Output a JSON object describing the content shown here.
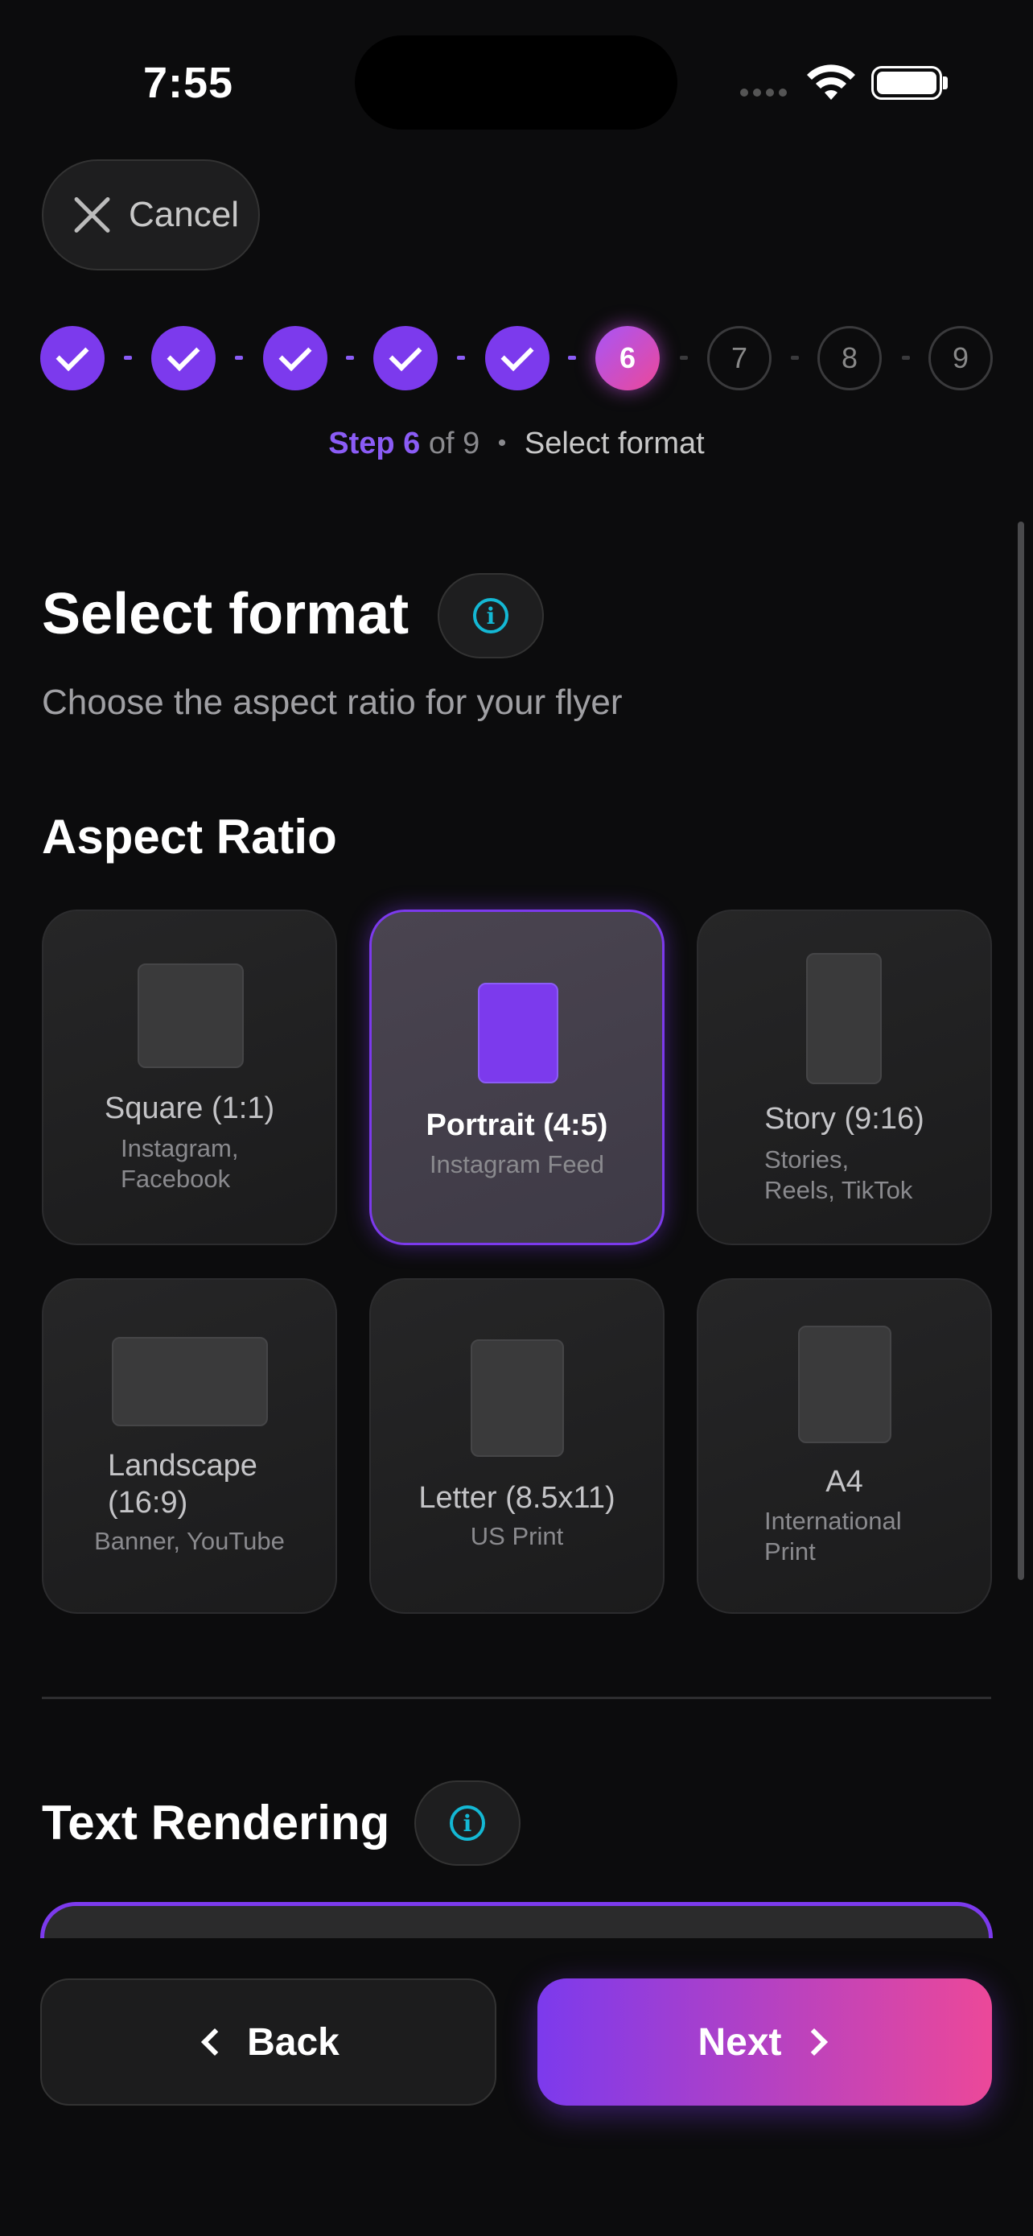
{
  "status_bar": {
    "time": "7:55"
  },
  "header": {
    "cancel_label": "Cancel"
  },
  "stepper": {
    "steps": [
      {
        "number": "1",
        "state": "done"
      },
      {
        "number": "2",
        "state": "done"
      },
      {
        "number": "3",
        "state": "done"
      },
      {
        "number": "4",
        "state": "done"
      },
      {
        "number": "5",
        "state": "done"
      },
      {
        "number": "6",
        "state": "current"
      },
      {
        "number": "7",
        "state": "todo"
      },
      {
        "number": "8",
        "state": "todo"
      },
      {
        "number": "9",
        "state": "todo"
      }
    ],
    "caption_step": "Step 6",
    "caption_of": "of 9",
    "caption_separator": "•",
    "caption_name": "Select format"
  },
  "page": {
    "title": "Select format",
    "subtitle": "Choose the aspect ratio for your flyer"
  },
  "aspect_ratio": {
    "heading": "Aspect Ratio",
    "selected": "Portrait (4:5)",
    "options": [
      {
        "title": "Square (1:1)",
        "desc_line1": "Instagram,",
        "desc_line2": "Facebook"
      },
      {
        "title": "Portrait (4:5)",
        "desc_line1": "Instagram Feed",
        "desc_line2": ""
      },
      {
        "title": "Story (9:16)",
        "desc_line1": "Stories,",
        "desc_line2": "Reels, TikTok"
      },
      {
        "title_line1": "Landscape",
        "title_line2": "(16:9)",
        "desc_line1": "Banner, YouTube",
        "desc_line2": ""
      },
      {
        "title": "Letter (8.5x11)",
        "desc_line1": "US Print",
        "desc_line2": ""
      },
      {
        "title": "A4",
        "desc_line1": "International",
        "desc_line2": "Print"
      }
    ]
  },
  "text_rendering": {
    "heading": "Text Rendering"
  },
  "footer": {
    "back_label": "Back",
    "next_label": "Next"
  },
  "colors": {
    "accent": "#7c3aed",
    "gradient_end": "#ec4899",
    "info": "#14b8d4",
    "background": "#0c0c0d"
  },
  "icons": [
    "close-icon",
    "check-icon",
    "info-icon",
    "chevron-left-icon",
    "chevron-right-icon",
    "wifi-icon",
    "battery-icon"
  ]
}
